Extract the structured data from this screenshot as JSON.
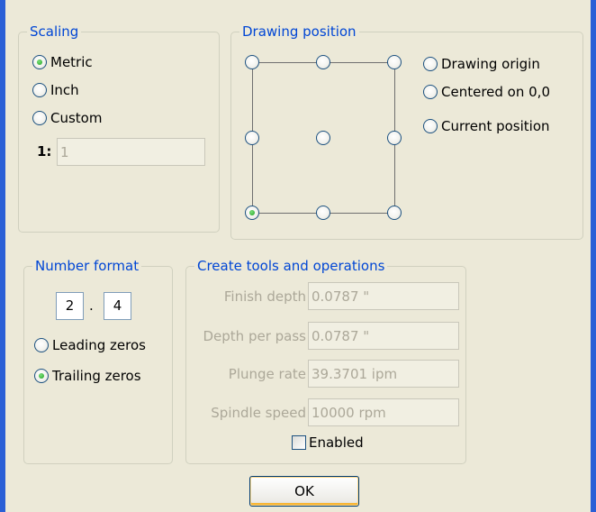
{
  "scaling": {
    "legend": "Scaling",
    "options": [
      "Metric",
      "Inch",
      "Custom"
    ],
    "selected": "Metric",
    "ratio_prefix": "1:",
    "ratio_value": "1"
  },
  "drawing_position": {
    "legend": "Drawing position",
    "selected_grid_point": "bottom-left",
    "options": [
      "Drawing origin",
      "Centered on 0,0",
      "Current position"
    ]
  },
  "number_format": {
    "legend": "Number format",
    "integer_digits": "2",
    "separator": ".",
    "decimal_digits": "4",
    "options": [
      "Leading zeros",
      "Trailing zeros"
    ],
    "selected": "Trailing zeros"
  },
  "create_tools": {
    "legend": "Create tools and operations",
    "fields": [
      {
        "label": "Finish depth",
        "value": "0.0787 \""
      },
      {
        "label": "Depth per pass",
        "value": "0.0787 \""
      },
      {
        "label": "Plunge rate",
        "value": "39.3701 ipm"
      },
      {
        "label": "Spindle speed",
        "value": "10000 rpm"
      }
    ],
    "enabled_label": "Enabled",
    "enabled": false
  },
  "ok_button": "OK",
  "colors": {
    "dialog_bg": "#ece9d8",
    "legend_text": "#0046d5",
    "window_frame": "#2a5fd6",
    "disabled_text": "#aca899"
  }
}
